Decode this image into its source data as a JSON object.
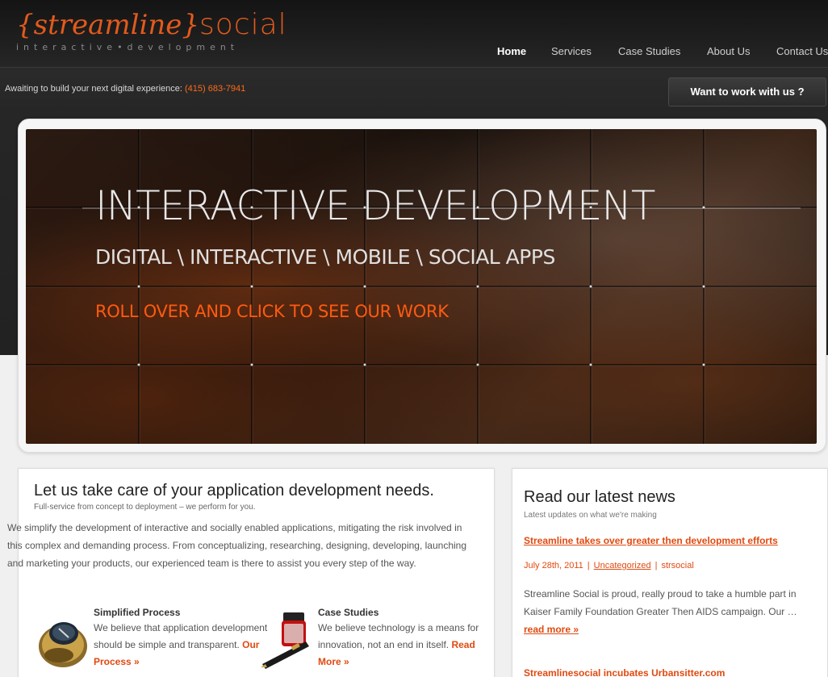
{
  "logo": {
    "brace_text": "{streamline}",
    "word": "social",
    "tagline": "interactive•development"
  },
  "nav": [
    {
      "label": "Home",
      "active": true
    },
    {
      "label": "Services"
    },
    {
      "label": "Case Studies"
    },
    {
      "label": "About Us"
    },
    {
      "label": "Contact Us"
    }
  ],
  "contact": {
    "text": "Awaiting to build your next digital experience:",
    "phone": "(415) 683-7941"
  },
  "cta_button": "Want to work with us ?",
  "hero": {
    "title": "INTERACTIVE DEVELOPMENT",
    "subtitle": "DIGITAL \\ INTERACTIVE \\ MOBILE \\ SOCIAL APPS",
    "cta": "ROLL OVER AND CLICK TO SEE OUR WORK"
  },
  "intro": {
    "title": "Let us take care of your application development needs.",
    "subtitle": "Full-service from concept to deployment – we perform for you.",
    "body": "We simplify the development of interactive and socially enabled applications, mitigating the risk involved in this complex and demanding process. From conceptualizing, researching, designing, developing, launching and marketing your products, our experienced team is there to assist you every step of the way."
  },
  "features": [
    {
      "title": "Simplified Process",
      "body": "We believe that application development should be simple and transparent.",
      "link": "Our Process »",
      "icon": "compass-icon"
    },
    {
      "title": "Case Studies",
      "body": "We believe technology is a means for innovation, not an end in itself.",
      "link": "Read More »",
      "icon": "fountain-pen-icon"
    }
  ],
  "news": {
    "title": "Read our latest news",
    "subtitle": "Latest updates on what we're making",
    "items": [
      {
        "title": "Streamline takes over greater then development efforts",
        "date": "July 28th, 2011",
        "category": "Uncategorized",
        "author": "strsocial",
        "excerpt": "Streamline Social is proud, really proud to take a humble part in Kaiser Family Foundation Greater Then AIDS campaign. Our …",
        "more": "read more »"
      },
      {
        "title": "Streamlinesocial incubates Urbansitter.com"
      }
    ]
  },
  "colors": {
    "accent": "#e04a10",
    "header_bg": "#1e1e1e",
    "page_bg": "#f0f0f0"
  }
}
